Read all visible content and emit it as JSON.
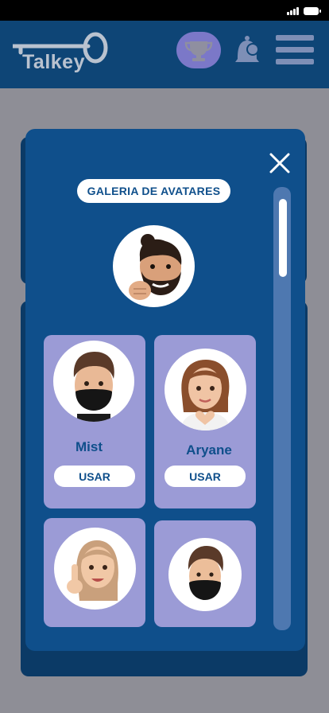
{
  "app": {
    "logo_text": "Talkey"
  },
  "header": {
    "icons": [
      "trophy-icon",
      "bell-icon",
      "menu-icon"
    ]
  },
  "modal": {
    "title": "GALERIA DE AVATARES",
    "close_icon": "close-icon",
    "current_avatar": "avatar-bearded-man-bun",
    "avatars": [
      {
        "name": "Mist",
        "button": "USAR",
        "image": "avatar-man-face-mask"
      },
      {
        "name": "Aryane",
        "button": "USAR",
        "image": "avatar-woman-heart-hands"
      },
      {
        "name": "",
        "button": "",
        "image": "avatar-woman-raised-finger"
      },
      {
        "name": "",
        "button": "",
        "image": "avatar-young-man-face-mask"
      }
    ]
  },
  "colors": {
    "header": "#0e4576",
    "modal": "#0f4f8b",
    "card": "#9b9bd6",
    "trophy_bg": "#7b78c8",
    "backdrop": "#8e8e96"
  }
}
